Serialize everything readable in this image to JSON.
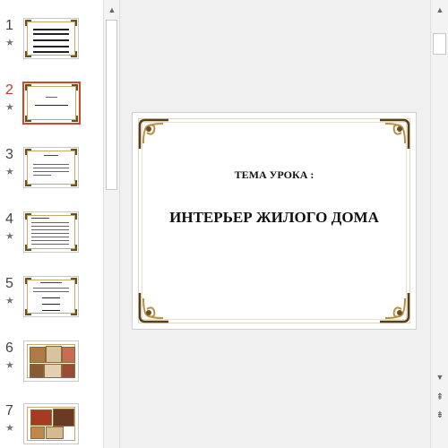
{
  "thumbnails": [
    {
      "number": "1",
      "star": "★"
    },
    {
      "number": "2",
      "star": "★"
    },
    {
      "number": "3",
      "star": "★"
    },
    {
      "number": "4",
      "star": "★"
    },
    {
      "number": "5",
      "star": "★"
    },
    {
      "number": "6",
      "star": "★"
    },
    {
      "number": "7",
      "star": "★"
    }
  ],
  "selected_slide": 2,
  "current_slide": {
    "subtitle": "ТЕМА УРОКА :",
    "title": "ИНТЕРЬЕР ЖИЛОГО ДОМА"
  },
  "icons": {
    "scroll_up": "▲",
    "scroll_down": "▼",
    "prev_slide": "⇞",
    "next_slide": "⇟"
  },
  "colors": {
    "selection": "#d24726",
    "frame_gold": "#c6a96a"
  }
}
